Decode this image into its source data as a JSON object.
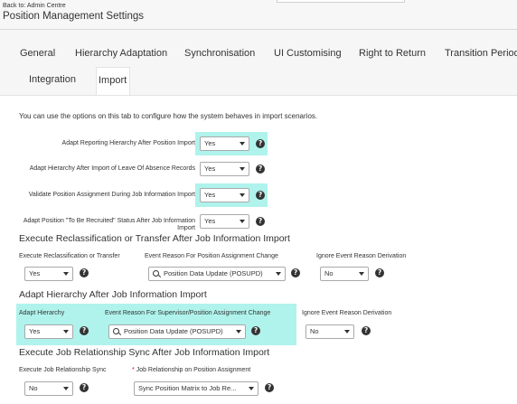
{
  "header": {
    "back_link": "Back to: Admin Centre",
    "title": "Position Management Settings"
  },
  "tabs": [
    {
      "label": "General"
    },
    {
      "label": "Hierarchy Adaptation"
    },
    {
      "label": "Synchronisation"
    },
    {
      "label": "UI Customising"
    },
    {
      "label": "Right to Return"
    },
    {
      "label": "Transition Period"
    },
    {
      "label": "Integration"
    },
    {
      "label": "Import"
    }
  ],
  "active_tab": "Import",
  "intro": "You can use the options on this tab to configure how the system behaves in import scenarios.",
  "settings": [
    {
      "label": "Adapt Reporting Hierarchy After Position Import",
      "value": "Yes",
      "highlighted": true
    },
    {
      "label": "Adapt Hierarchy After Import of Leave Of Absence Records",
      "value": "Yes",
      "highlighted": false
    },
    {
      "label": "Validate Position Assignment During Job Information Import",
      "value": "Yes",
      "highlighted": true
    },
    {
      "label": "Adapt Position \"To Be Recruited\" Status After Job Information Import",
      "value": "Yes",
      "highlighted": false
    }
  ],
  "section1": {
    "title": "Execute Reclassification or Transfer After Job Information Import",
    "field1_label": "Execute Reclassification or Transfer",
    "field1_value": "Yes",
    "field2_label": "Event Reason For Position Assignment Change",
    "field2_value": "Position Data Update (POSUPD)",
    "field3_label": "Ignore Event Reason Derivation",
    "field3_value": "No"
  },
  "section2": {
    "title": "Adapt Hierarchy After Job Information Import",
    "field1_label": "Adapt Hierarchy",
    "field1_value": "Yes",
    "field2_label": "Event Reason For Supervisor/Position Assignment Change",
    "field2_value": "Position Data Update (POSUPD)",
    "field3_label": "Ignore Event Reason Derivation",
    "field3_value": "No"
  },
  "section3": {
    "title": "Execute Job Relationship Sync After Job Information Import",
    "field1_label": "Execute Job Relationship Sync",
    "field1_value": "No",
    "field2_required_marker": "*",
    "field2_label": "Job Relationship on Position Assignment",
    "field2_value": "Sync Position Matrix to Job Re..."
  },
  "help_glyph": "?",
  "colors": {
    "highlight": "#aff3ec",
    "required": "#d0021b",
    "header_bg": "#f7f7f7",
    "tab_bar_bg": "#f6f6f6"
  },
  "icons": [
    "search-icon",
    "chevron-down-icon",
    "help-icon"
  ]
}
